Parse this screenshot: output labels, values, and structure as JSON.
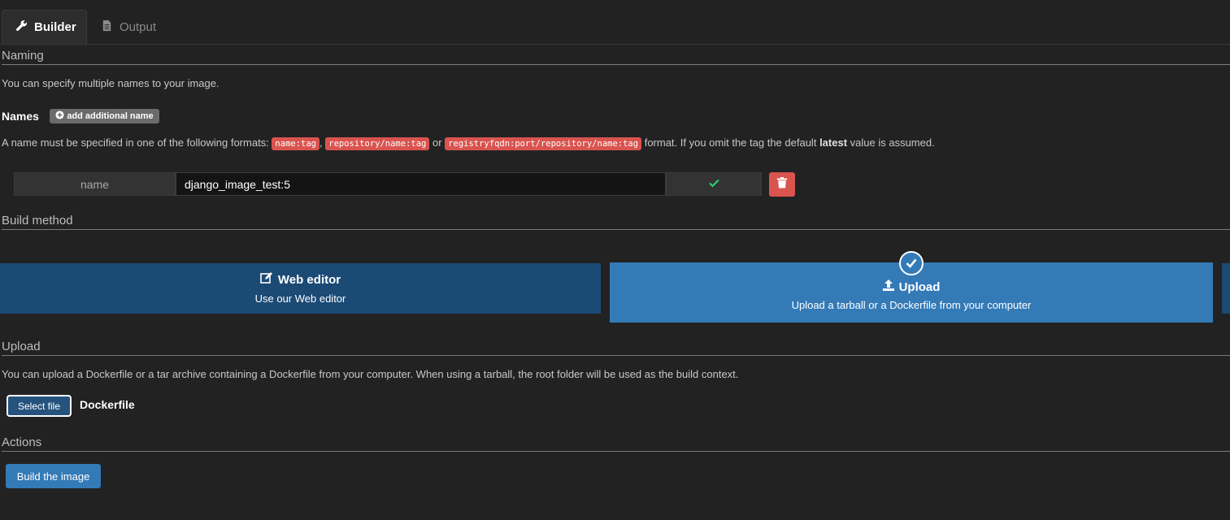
{
  "tabs": [
    {
      "label": "Builder",
      "icon": "wrench-icon",
      "active": true
    },
    {
      "label": "Output",
      "icon": "file-icon",
      "active": false
    }
  ],
  "naming": {
    "title": "Naming",
    "description": "You can specify multiple names to your image.",
    "names_label": "Names",
    "add_button": "add additional name",
    "format_prefix": "A name must be specified in one of the following formats:",
    "format_1": "name:tag",
    "sep_1": ",",
    "format_2": "repository/name:tag",
    "sep_2": "or",
    "format_3": "registryfqdn:port/repository/name:tag",
    "format_suffix_1": "format. If you omit the tag the default",
    "format_bold": "latest",
    "format_suffix_2": "value is assumed.",
    "row": {
      "label": "name",
      "value": "django_image_test:5",
      "valid": true
    }
  },
  "build_method": {
    "title": "Build method",
    "options": [
      {
        "title": "Web editor",
        "desc": "Use our Web editor",
        "icon": "edit-icon",
        "selected": false
      },
      {
        "title": "Upload",
        "desc": "Upload a tarball or a Dockerfile from your computer",
        "icon": "upload-icon",
        "selected": true
      }
    ]
  },
  "upload": {
    "title": "Upload",
    "description": "You can upload a Dockerfile or a tar archive containing a Dockerfile from your computer. When using a tarball, the root folder will be used as the build context.",
    "select_button": "Select file",
    "file_name": "Dockerfile"
  },
  "actions": {
    "title": "Actions",
    "build_button": "Build the image"
  },
  "colors": {
    "background": "#222222",
    "primary": "#337ab7",
    "primary_dark": "#1b4a75",
    "danger": "#d9534f",
    "success": "#2ecc71"
  }
}
